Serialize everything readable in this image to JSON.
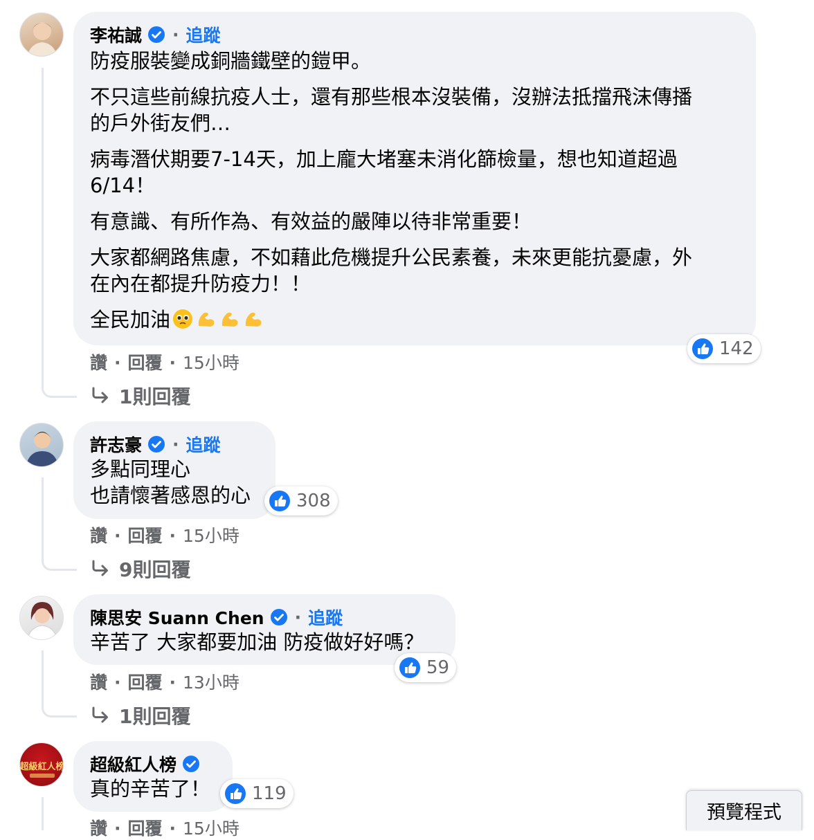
{
  "comments": [
    {
      "author": "李祐誠",
      "follow": "追蹤",
      "paragraphs": [
        [
          "防疫服裝變成銅牆鐵壁的鎧甲。"
        ],
        [
          "不只這些前線抗疫人士，還有那些根本沒裝備，沒辦法抵擋飛沫傳播",
          "的戶外街友們…"
        ],
        [
          "病毒潛伏期要7-14天，加上龐大堵塞未消化篩檢量，想也知道超過",
          "6/14！"
        ],
        [
          "有意識、有所作為、有效益的嚴陣以待非常重要！"
        ],
        [
          "大家都網路焦慮，不如藉此危機提升公民素養，未來更能抗憂慮，外",
          "在內在都提升防疫力！！"
        ],
        [
          "全民加油"
        ]
      ],
      "emojis": [
        "pleading-face-icon",
        "flexed-biceps-icon",
        "flexed-biceps-icon",
        "flexed-biceps-icon"
      ],
      "likes": "142",
      "actions": {
        "like": "讚",
        "reply": "回覆",
        "time": "15小時"
      },
      "replies": "1則回覆"
    },
    {
      "author": "許志豪",
      "follow": "追蹤",
      "lines": [
        "多點同理心",
        "也請懷著感恩的心"
      ],
      "likes": "308",
      "actions": {
        "like": "讚",
        "reply": "回覆",
        "time": "15小時"
      },
      "replies": "9則回覆"
    },
    {
      "author": "陳思安 Suann Chen",
      "follow": "追蹤",
      "lines": [
        "辛苦了 大家都要加油 防疫做好好嗎？"
      ],
      "likes": "59",
      "actions": {
        "like": "讚",
        "reply": "回覆",
        "time": "13小時"
      },
      "replies": "1則回覆"
    },
    {
      "author": "超級紅人榜",
      "lines": [
        "真的辛苦了！"
      ],
      "likes": "119",
      "actions": {
        "like": "讚",
        "reply": "回覆",
        "time": "15小時"
      }
    }
  ],
  "avatar4_logo_text": "超級紅人榜",
  "separator": "·",
  "preview_button": "預覽程式",
  "colors": {
    "bubble": "#f0f2f5",
    "link": "#1877f2",
    "muted": "#65676b",
    "like": "#1877f2"
  }
}
